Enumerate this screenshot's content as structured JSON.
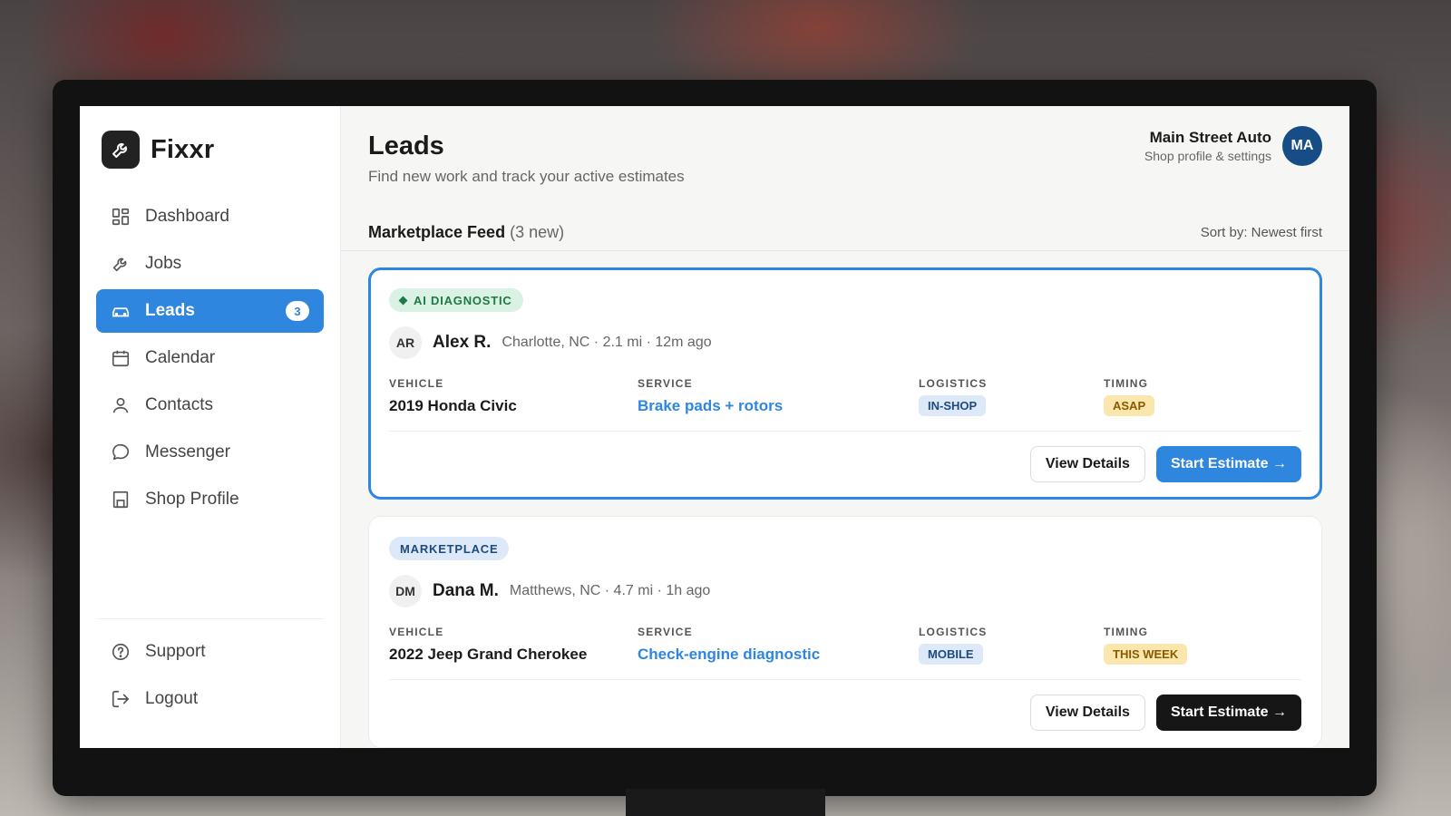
{
  "brand": {
    "name": "Fixxr"
  },
  "nav": {
    "items": [
      {
        "label": "Dashboard"
      },
      {
        "label": "Jobs"
      },
      {
        "label": "Leads",
        "badge": "3"
      },
      {
        "label": "Calendar"
      },
      {
        "label": "Contacts"
      },
      {
        "label": "Messenger"
      },
      {
        "label": "Shop Profile"
      }
    ],
    "bottom": [
      {
        "label": "Support"
      },
      {
        "label": "Logout"
      }
    ]
  },
  "header": {
    "title": "Leads",
    "subtitle": "Find new work and track your active estimates",
    "account_name": "Main Street Auto",
    "account_sub": "Shop profile & settings",
    "avatar": "MA"
  },
  "feed": {
    "title": "Marketplace Feed",
    "count": "(3 new)",
    "sort": "Sort by: Newest first"
  },
  "labels": {
    "vehicle": "VEHICLE",
    "service": "SERVICE",
    "logistics": "LOGISTICS",
    "timing": "TIMING",
    "view_details": "View Details",
    "start_estimate": "Start Estimate →"
  },
  "leads": [
    {
      "tag": "AI DIAGNOSTIC",
      "initials": "AR",
      "name": "Alex R.",
      "meta": "Charlotte, NC · 2.1 mi · 12m ago",
      "vehicle": "2019 Honda Civic",
      "service": "Brake pads + rotors",
      "logistics": "IN-SHOP",
      "timing": "ASAP"
    },
    {
      "tag": "MARKETPLACE",
      "initials": "DM",
      "name": "Dana M.",
      "meta": "Matthews, NC · 4.7 mi · 1h ago",
      "vehicle": "2022 Jeep Grand Cherokee",
      "service": "Check-engine diagnostic",
      "logistics": "MOBILE",
      "timing": "THIS WEEK"
    }
  ],
  "colors": {
    "accent": "#2e86de",
    "dark_button": "#161616",
    "avatar": "#164d86"
  }
}
